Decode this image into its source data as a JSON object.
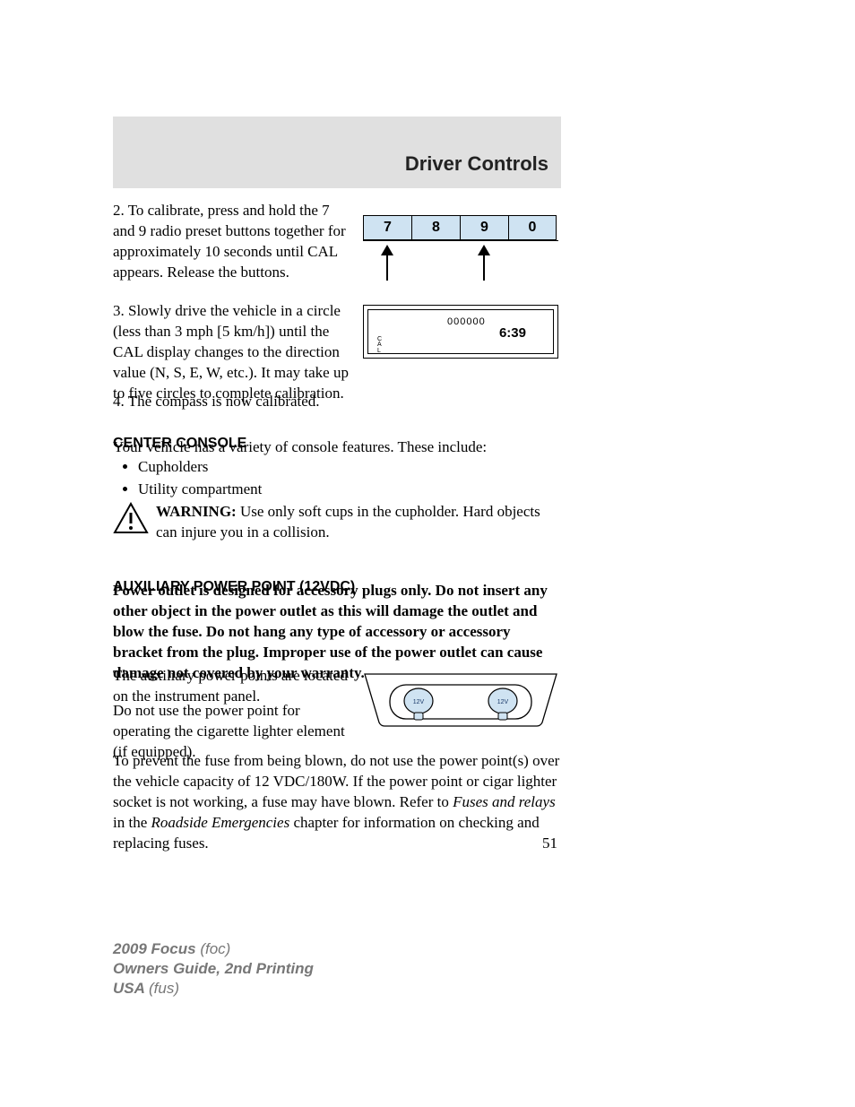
{
  "header": {
    "title": "Driver Controls"
  },
  "steps": {
    "s2": "2. To calibrate, press and hold the 7 and 9 radio preset buttons together for approximately 10 seconds until CAL appears. Release the buttons.",
    "s3": "3. Slowly drive the vehicle in a circle (less than 3 mph [5 km/h]) until the CAL display changes to the direction value (N, S, E, W, etc.). It may take up to five circles to complete calibration.",
    "s4": "4. The compass is now calibrated."
  },
  "sections": {
    "center_console_heading": "CENTER CONSOLE",
    "center_console_intro": "Your vehicle has a variety of console features. These include:",
    "bullets": [
      "Cupholders",
      "Utility compartment"
    ],
    "warning_label": "WARNING:",
    "warning_text": " Use only soft cups in the cupholder. Hard objects can injure you in a collision.",
    "aux_heading": "AUXILIARY POWER POINT (12VDC)",
    "aux_bold": "Power outlet is designed for accessory plugs only. Do not insert any other object in the power outlet as this will damage the outlet and blow the fuse. Do not hang any type of accessory or accessory bracket from the plug. Improper use of the power outlet can cause damage not covered by your warranty.",
    "aux_p1": "The auxiliary power points are located on the instrument panel.",
    "aux_p2": "Do not use the power point for operating the cigarette lighter element (if equipped).",
    "aux_p3_a": "To prevent the fuse from being blown, do not use the power point(s) over the vehicle capacity of 12 VDC/180W. If the power point or cigar lighter socket is not working, a fuse may have blown. Refer to ",
    "aux_p3_i1": "Fuses and relays",
    "aux_p3_b": " in the ",
    "aux_p3_i2": "Roadside Emergencies",
    "aux_p3_c": " chapter for information on checking and replacing fuses."
  },
  "fig1": {
    "buttons": [
      "7",
      "8",
      "9",
      "0"
    ]
  },
  "fig2": {
    "odometer": "000000",
    "time": "6:39",
    "cal": "C\nA\nL"
  },
  "fig3": {
    "label": "12V"
  },
  "page_number": "51",
  "footer": {
    "l1a": "2009 Focus ",
    "l1b": "(foc)",
    "l2": "Owners Guide, 2nd Printing",
    "l3a": "USA ",
    "l3b": "(fus)"
  }
}
